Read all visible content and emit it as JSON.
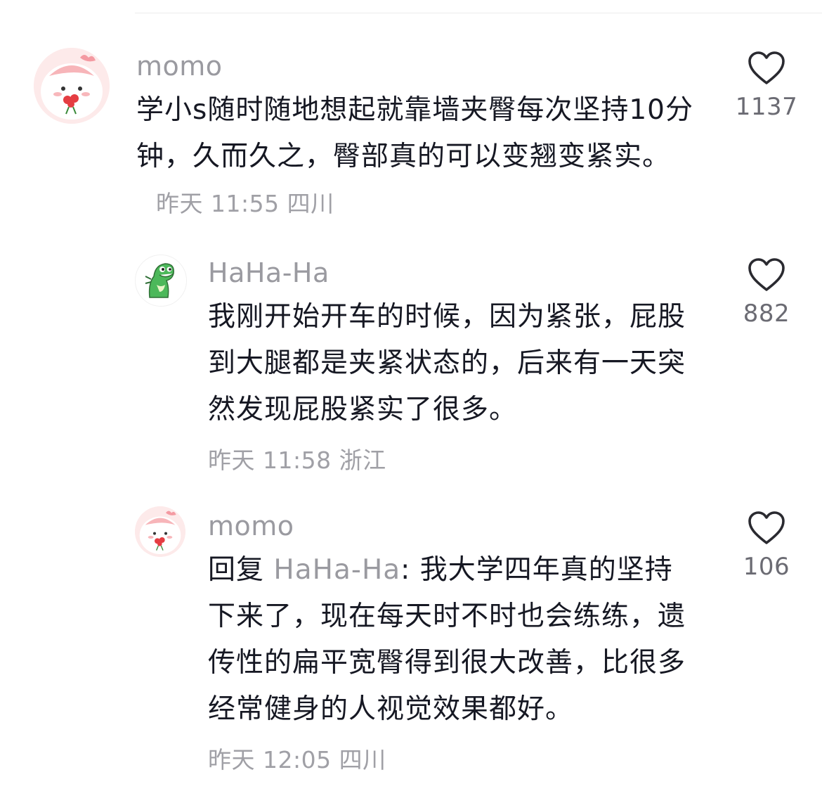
{
  "comments": [
    {
      "username": "momo",
      "text": "学小s随时随地想起就靠墙夹臀每次坚持10分钟，久而久之，臀部真的可以变翘变紧实。",
      "time": "昨天 11:55",
      "location": "四川",
      "likes": "1137",
      "avatar": "pink-blob-avatar"
    },
    {
      "username": "HaHa-Ha",
      "text": "我刚开始开车的时候，因为紧张，屁股到大腿都是夹紧状态的，后来有一天突然发现屁股紧实了很多。",
      "time": "昨天 11:58",
      "location": "浙江",
      "likes": "882",
      "avatar": "green-dino-avatar"
    },
    {
      "username": "momo",
      "reply_prefix": "回复",
      "reply_target": "HaHa-Ha",
      "text": ": 我大学四年真的坚持下来了，现在每天时不时也会练练，遗传性的扁平宽臀得到很大改善，比很多经常健身的人视觉效果都好。",
      "time": "昨天 12:05",
      "location": "四川",
      "likes": "106",
      "avatar": "pink-blob-avatar"
    }
  ],
  "icons": {
    "like": "heart-outline-icon"
  },
  "colors": {
    "text": "#161823",
    "muted": "#9a9aa0",
    "like_count": "#6b6b73"
  }
}
